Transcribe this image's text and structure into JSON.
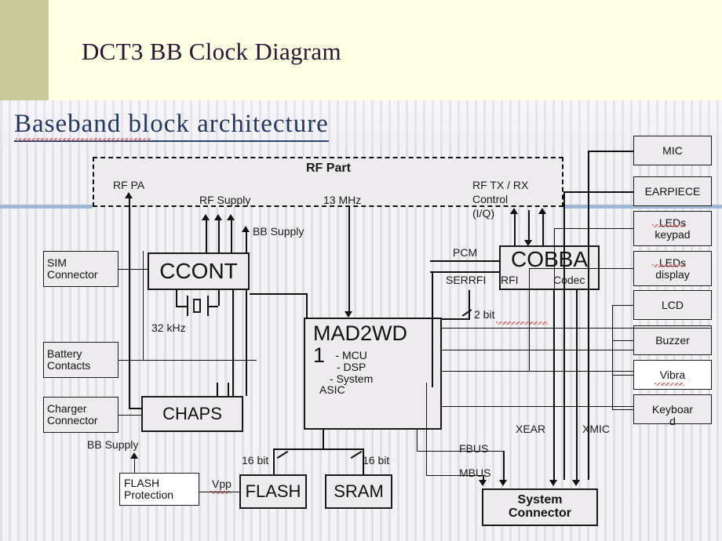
{
  "slide": {
    "title": "DCT3 BB Clock Diagram",
    "diagram_heading": "Baseband block architecture",
    "accent_sidebar_color": "#cacb9c",
    "title_band_color": "#fdffe3",
    "title_text_color": "#2b1436",
    "heading_color": "#1f3864",
    "rule_color": "#9fb8d8"
  },
  "rf_part": {
    "title": "RF Part",
    "labels": {
      "rf_pa": "RF PA",
      "rf_supply": "RF Supply",
      "clock_13mhz": "13 MHz",
      "rf_txrx_control": "RF TX / RX",
      "rf_txrx_control2": "Control",
      "rf_txrx_control3": "(I/Q)"
    }
  },
  "blocks": {
    "sim_connector_l1": "SIM",
    "sim_connector_l2": "Connector",
    "battery_l1": "Battery",
    "battery_l2": "Contacts",
    "charger_l1": "Charger",
    "charger_l2": "Connector",
    "ccont": "CCONT",
    "chaps": "CHAPS",
    "mad_title": "MAD2WD",
    "mad_num": "1",
    "mad_line1": "- MCU",
    "mad_line2": "- DSP",
    "mad_line3": "- System",
    "mad_line4": "ASIC",
    "cobba": "COBBA",
    "cobba_rfi": "RFI",
    "cobba_codec": "Codec",
    "flash_protection_l1": "FLASH",
    "flash_protection_l2": "Protection",
    "flash": "FLASH",
    "sram": "SRAM",
    "system_connector_l1": "System",
    "system_connector_l2": "Connector"
  },
  "peripherals": [
    {
      "label": "MIC"
    },
    {
      "label": "EARPIECE"
    },
    {
      "label": "LEDs",
      "label2": "keypad",
      "spell_error": true
    },
    {
      "label": "LEDs",
      "label2": "display",
      "spell_error": true
    },
    {
      "label": "LCD"
    },
    {
      "label": "Buzzer"
    },
    {
      "label": "Vibra",
      "spell_error": true,
      "white": true
    },
    {
      "label": "Keyboar",
      "label2": "d"
    }
  ],
  "signals": {
    "bb_supply_top": "BB Supply",
    "clock_32khz": "32 kHz",
    "pcm": "PCM",
    "serrfi": "SERRFI",
    "two_bit": "2 bit",
    "bb_supply_bottom": "BB Supply",
    "vpp": "Vpp",
    "flash_bits": "16 bit",
    "sram_bits": "16 bit",
    "fbus": "FBUS",
    "mbus": "MBUS",
    "xear": "XEAR",
    "xmic": "XMIC"
  }
}
